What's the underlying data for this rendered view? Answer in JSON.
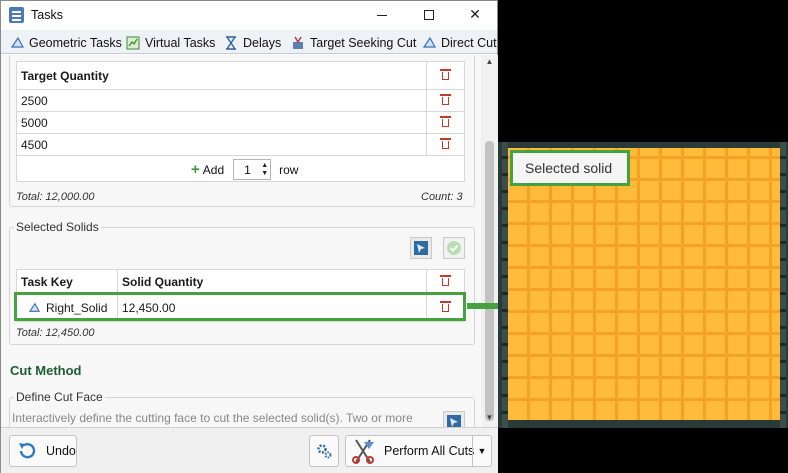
{
  "window": {
    "title": "Tasks",
    "min_glyph": "",
    "max_glyph": "",
    "close_glyph": "✕"
  },
  "tabs": [
    {
      "label": "Geometric Tasks",
      "icon": "geometric-tasks-icon"
    },
    {
      "label": "Virtual Tasks",
      "icon": "virtual-tasks-icon"
    },
    {
      "label": "Delays",
      "icon": "hourglass-icon"
    },
    {
      "label": "Target Seeking Cut",
      "icon": "target-cut-icon"
    },
    {
      "label": "Direct Cut",
      "icon": "direct-cut-icon"
    }
  ],
  "target_table": {
    "header": "Target Quantity",
    "rows": [
      "2500",
      "5000",
      "4500"
    ],
    "add_label": "Add",
    "add_count": "1",
    "row_label": "row",
    "total": "Total: 12,000.00",
    "count": "Count: 3"
  },
  "selected_solids": {
    "legend": "Selected Solids",
    "col_task_key": "Task Key",
    "col_solid_quantity": "Solid Quantity",
    "rows": [
      {
        "task_key": "Right_Solid",
        "solid_quantity": "12,450.00"
      }
    ],
    "total": "Total: 12,450.00"
  },
  "cut_method": {
    "title": "Cut Method",
    "define_legend": "Define Cut Face",
    "description": "Interactively define the cutting face to cut the selected solid(s). Two or more"
  },
  "bottom": {
    "undo_label": "Undo",
    "perform_label": "Perform All Cuts"
  },
  "viewport": {
    "label": "Selected solid"
  },
  "colors": {
    "highlight": "#46a23f",
    "solid_fill": "#ffbc3a",
    "solid_grid": "#f5a123",
    "section_title": "#1f5c32",
    "delete_red": "#c0392b"
  }
}
